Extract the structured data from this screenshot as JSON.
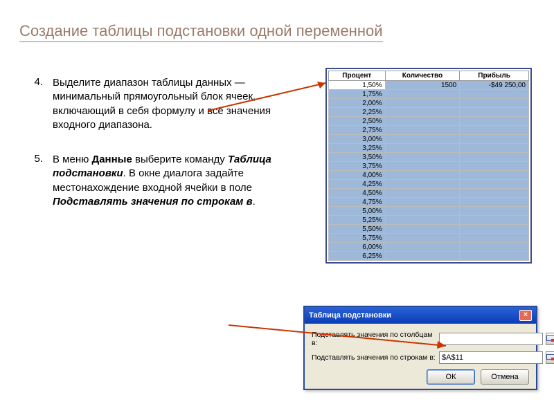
{
  "title": "Создание таблицы подстановки одной переменной",
  "instructions": [
    {
      "num": "4.",
      "parts": [
        {
          "t": "Выделите диапазон таблицы данных — минимальный прямоугольный блок ячеек, включающий в себя формулу и все значения входного диапазона."
        }
      ]
    },
    {
      "num": "5.",
      "parts": [
        {
          "t": "В меню "
        },
        {
          "t": "Данные",
          "b": true
        },
        {
          "t": " выберите команду "
        },
        {
          "t": "Таблица подстановки",
          "b": true,
          "i": true
        },
        {
          "t": ". В окне диалога задайте местонахождение входной ячейки в поле "
        },
        {
          "t": "Подставлять значения по строкам в",
          "b": true,
          "i": true
        },
        {
          "t": "."
        }
      ]
    }
  ],
  "table": {
    "headers": [
      "Процент",
      "Количество",
      "Прибыль"
    ],
    "first_row": {
      "percent": "1,50%",
      "qty": "1500",
      "profit": "-$49 250,00"
    },
    "percents": [
      "1,75%",
      "2,00%",
      "2,25%",
      "2,50%",
      "2,75%",
      "3,00%",
      "3,25%",
      "3,50%",
      "3,75%",
      "4,00%",
      "4,25%",
      "4,50%",
      "4,75%",
      "5,00%",
      "5,25%",
      "5,50%",
      "5,75%",
      "6,00%",
      "6,25%"
    ]
  },
  "dialog": {
    "title": "Таблица подстановки",
    "label_cols": "Подставлять значения по столбцам в:",
    "label_rows": "Подставлять значения по строкам в:",
    "value_cols": "",
    "value_rows": "$A$11",
    "ok": "ОК",
    "cancel": "Отмена",
    "close": "×"
  }
}
